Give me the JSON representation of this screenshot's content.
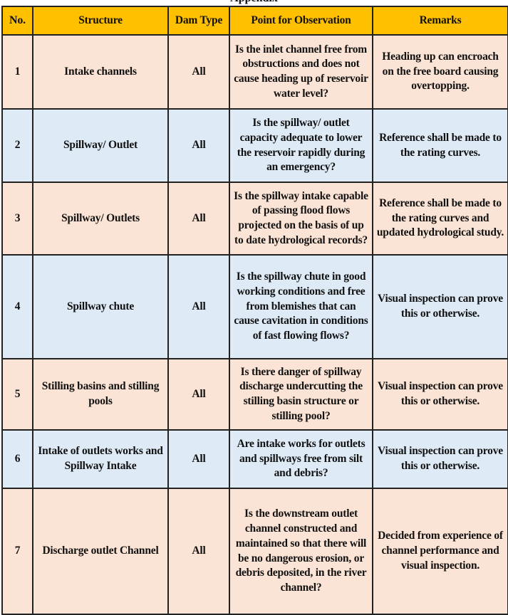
{
  "document": {
    "caption_partial": "Appendix",
    "colors": {
      "header_bg": "#FFC000",
      "row_odd_bg": "#FBE4D5",
      "row_even_bg": "#DEEAF6",
      "border": "#222222"
    },
    "table": {
      "headers": {
        "no": "No.",
        "structure": "Structure",
        "dam_type": "Dam Type",
        "point": "Point for Observation",
        "remarks": "Remarks"
      },
      "rows": [
        {
          "no": "1",
          "structure": "Intake channels",
          "dam_type": "All",
          "point": "Is the inlet channel free from obstructions and does not cause heading up of reservoir water level?",
          "remarks": "Heading up can encroach    on the free board causing overtopping."
        },
        {
          "no": "2",
          "structure": "Spillway/ Outlet",
          "dam_type": "All",
          "point": "Is the spillway/ outlet capacity adequate to lower the reservoir rapidly during an emergency?",
          "remarks": "Reference shall be made to the rating curves."
        },
        {
          "no": "3",
          "structure": "Spillway/ Outlets",
          "dam_type": "All",
          "point": "Is the spillway intake capable of passing flood flows projected on the basis of up to date hydrological records?",
          "remarks": "Reference shall be made to the rating curves and updated hydrological study."
        },
        {
          "no": "4",
          "structure": "Spillway chute",
          "dam_type": "All",
          "point": "Is the spillway chute in good working conditions and free from blemishes that can cause cavitation in conditions of fast flowing flows?",
          "remarks": "Visual inspection can prove this or otherwise."
        },
        {
          "no": "5",
          "structure": "Stilling basins and stilling pools",
          "dam_type": "All",
          "point": "Is there danger of spillway discharge undercutting the stilling basin structure or stilling pool?",
          "remarks": "Visual inspection can prove this or otherwise."
        },
        {
          "no": "6",
          "structure": "Intake of outlets works and Spillway Intake",
          "dam_type": "All",
          "point": "Are intake works for outlets and spillways free from silt and debris?",
          "remarks": "Visual inspection can prove this or otherwise."
        },
        {
          "no": "7",
          "structure": "Discharge outlet Channel",
          "dam_type": "All",
          "point": "Is the downstream outlet channel constructed and maintained so that there will be no dangerous erosion, or debris deposited, in the river channel?",
          "remarks": "Decided from experience of channel performance and visual inspection."
        }
      ]
    }
  }
}
